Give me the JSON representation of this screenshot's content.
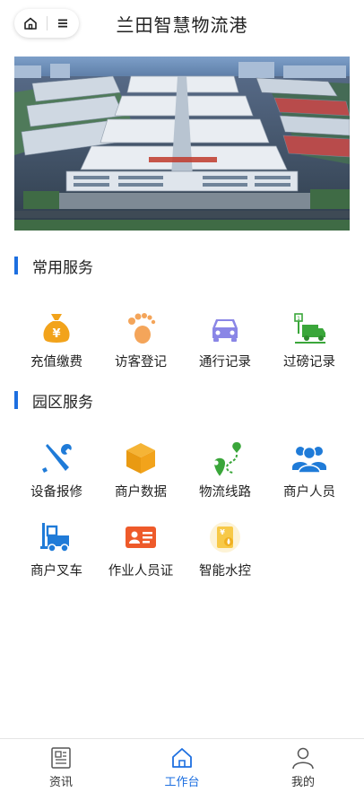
{
  "header": {
    "title": "兰田智慧物流港"
  },
  "sections": {
    "common": {
      "title": "常用服务",
      "items": [
        {
          "label": "充值缴费",
          "icon": "money-bag-icon"
        },
        {
          "label": "访客登记",
          "icon": "footprint-icon"
        },
        {
          "label": "通行记录",
          "icon": "car-icon"
        },
        {
          "label": "过磅记录",
          "icon": "weighbridge-truck-icon"
        }
      ]
    },
    "park": {
      "title": "园区服务",
      "items": [
        {
          "label": "设备报修",
          "icon": "wrench-screwdriver-icon"
        },
        {
          "label": "商户数据",
          "icon": "box-icon"
        },
        {
          "label": "物流线路",
          "icon": "route-pin-icon"
        },
        {
          "label": "商户人员",
          "icon": "people-group-icon"
        },
        {
          "label": "商户叉车",
          "icon": "forklift-icon"
        },
        {
          "label": "作业人员证",
          "icon": "id-card-icon"
        },
        {
          "label": "智能水控",
          "icon": "water-card-icon"
        }
      ]
    }
  },
  "tabbar": {
    "items": [
      {
        "label": "资讯",
        "icon": "news-icon"
      },
      {
        "label": "工作台",
        "icon": "home-icon"
      },
      {
        "label": "我的",
        "icon": "user-icon"
      }
    ],
    "active": "工作台"
  },
  "colors": {
    "accent": "#1d6fe0",
    "money": "#f2a31b",
    "foot": "#f4a55a",
    "car": "#8a86e6",
    "green": "#3aa63a",
    "blue": "#1f7bd8",
    "orange": "#e98a1f",
    "red": "#ee5a2a"
  }
}
